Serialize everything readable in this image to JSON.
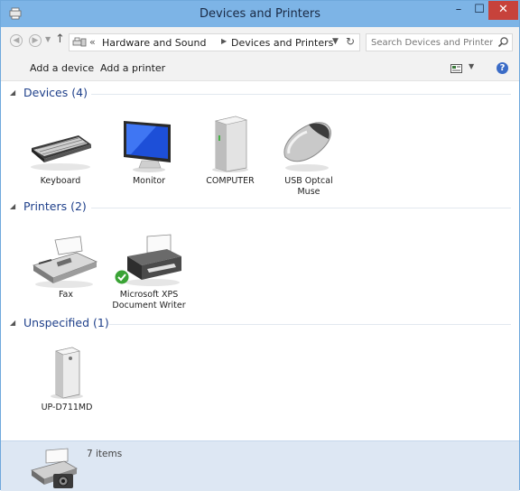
{
  "window": {
    "title": "Devices and Printers"
  },
  "controls": {
    "minimize": "–",
    "maximize": "☐",
    "close": "✕"
  },
  "address": {
    "path_prefix": "«",
    "crumbs": [
      "Hardware and Sound",
      "Devices and Printers"
    ]
  },
  "search": {
    "placeholder": "Search Devices and Printers"
  },
  "commands": {
    "add_device": "Add a device",
    "add_printer": "Add a printer"
  },
  "groups": [
    {
      "title": "Devices (4)",
      "items": [
        "Keyboard",
        "Monitor",
        "COMPUTER",
        "USB Optcal Muse"
      ]
    },
    {
      "title": "Printers (2)",
      "items": [
        "Fax",
        "Microsoft XPS Document Writer"
      ]
    },
    {
      "title": "Unspecified (1)",
      "items": [
        "UP-D711MD"
      ]
    }
  ],
  "details": {
    "count": "7 items"
  },
  "colors": {
    "titlebar": "#7db4e6",
    "close": "#c7423b",
    "group_title": "#1e3f8a",
    "details_pane": "#dde7f3"
  },
  "icons": [
    "app-icon",
    "back-icon",
    "forward-icon",
    "up-arrow-icon",
    "devices-printers-icon",
    "refresh-icon",
    "search-icon",
    "view-icon",
    "help-icon",
    "keyboard-icon",
    "monitor-icon",
    "computer-icon",
    "mouse-icon",
    "fax-icon",
    "printer-icon",
    "default-check-icon",
    "device-icon",
    "details-printer-camera-icon"
  ]
}
